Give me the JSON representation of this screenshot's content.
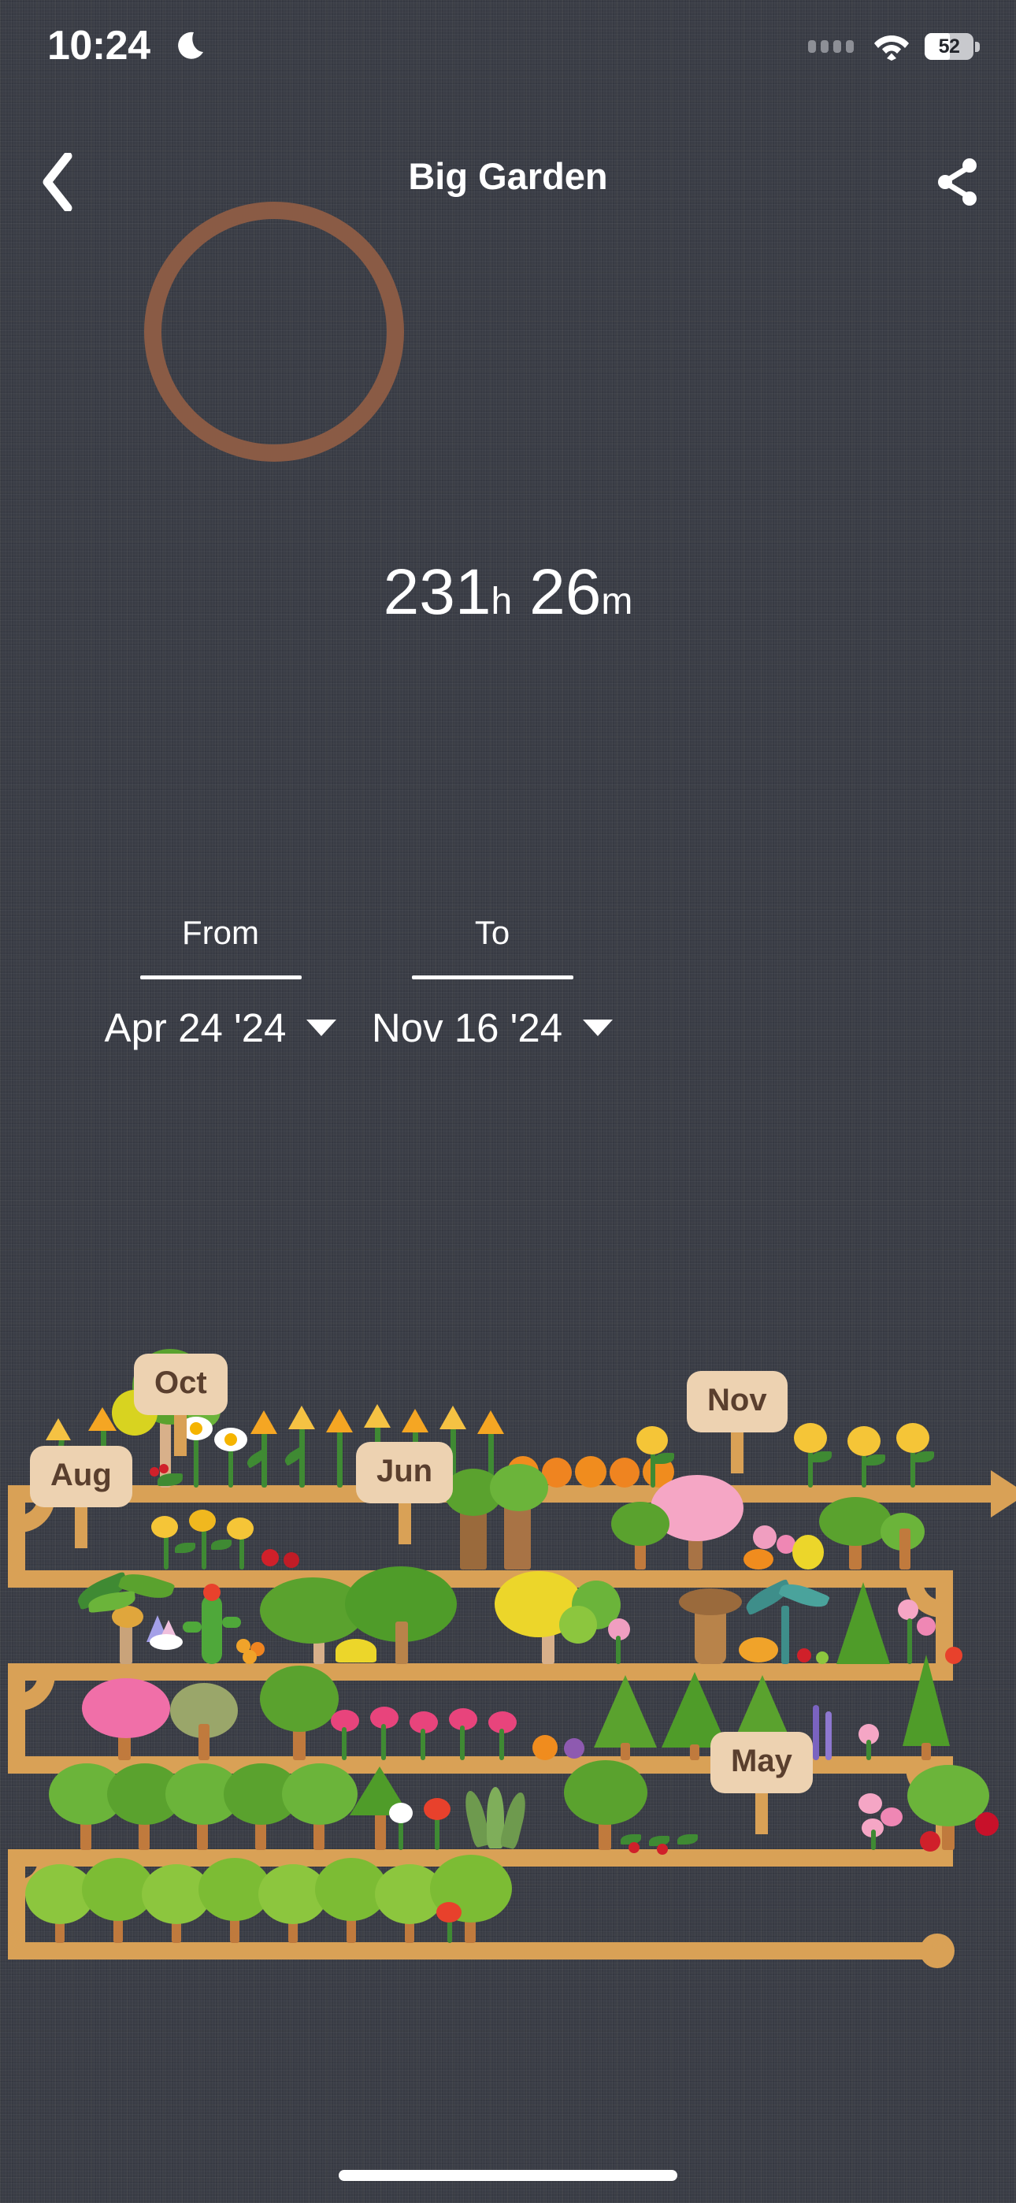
{
  "status_bar": {
    "time": "10:24",
    "dnd_icon": "crescent-moon-icon",
    "cellular_icon": "cellular-dots-icon",
    "wifi_icon": "wifi-icon",
    "battery_percent": "52",
    "battery_icon": "battery-icon"
  },
  "header": {
    "back_icon": "chevron-left-icon",
    "title": "Big Garden",
    "share_icon": "share-icon"
  },
  "timer": {
    "hours": "231",
    "hours_unit": "h",
    "minutes": "26",
    "minutes_unit": "m",
    "ring_color": "#8a5b45"
  },
  "date_range": {
    "from": {
      "label": "From",
      "value": "Apr 24 '24",
      "caret_icon": "chevron-down-icon"
    },
    "to": {
      "label": "To",
      "value": "Nov 16 '24",
      "caret_icon": "chevron-down-icon"
    }
  },
  "garden": {
    "shelf_color": "#d9a156",
    "sign_board_color": "#edd2b1",
    "sign_text_color": "#5a3f2e",
    "start_marker_icon": "timeline-start-dot",
    "end_marker_icon": "timeline-arrow-icon",
    "month_signs": [
      {
        "label": "Oct",
        "row": 1
      },
      {
        "label": "Nov",
        "row": 1
      },
      {
        "label": "Aug",
        "row": 2
      },
      {
        "label": "Jun",
        "row": 2
      },
      {
        "label": "May",
        "row": 5
      }
    ]
  }
}
